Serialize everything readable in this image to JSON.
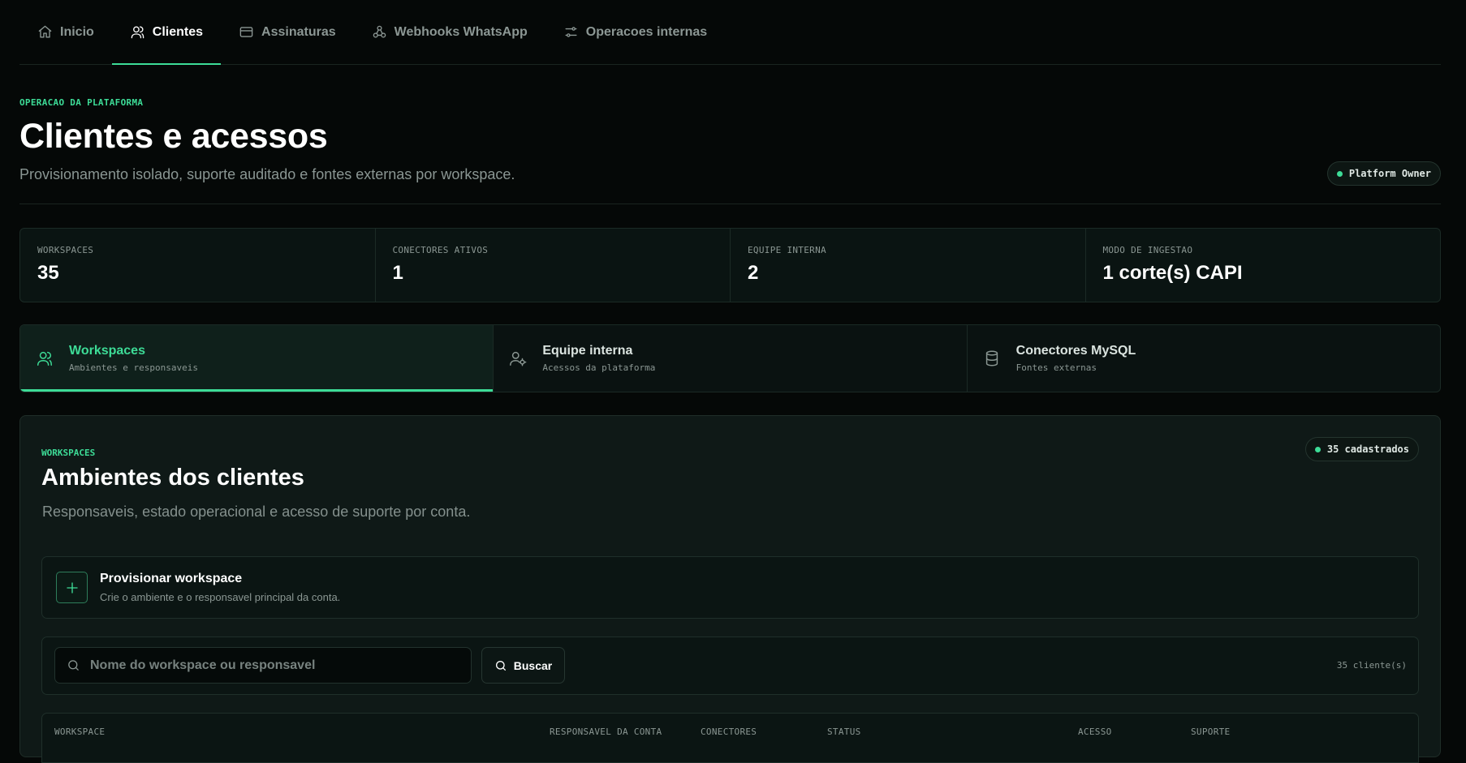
{
  "nav": [
    {
      "label": "Inicio",
      "icon": "home-icon",
      "active": false
    },
    {
      "label": "Clientes",
      "icon": "users-icon",
      "active": true
    },
    {
      "label": "Assinaturas",
      "icon": "credit-card-icon",
      "active": false
    },
    {
      "label": "Webhooks WhatsApp",
      "icon": "webhook-icon",
      "active": false
    },
    {
      "label": "Operacoes internas",
      "icon": "sliders-icon",
      "active": false
    }
  ],
  "header": {
    "eyebrow": "OPERACAO DA PLATAFORMA",
    "title": "Clientes e acessos",
    "subtitle": "Provisionamento isolado, suporte auditado e fontes externas por workspace.",
    "role_badge": "Platform Owner"
  },
  "stats": [
    {
      "label": "WORKSPACES",
      "value": "35"
    },
    {
      "label": "CONECTORES ATIVOS",
      "value": "1"
    },
    {
      "label": "EQUIPE INTERNA",
      "value": "2"
    },
    {
      "label": "MODO DE INGESTAO",
      "value": "1 corte(s) CAPI"
    }
  ],
  "tabs": [
    {
      "title": "Workspaces",
      "subtitle": "Ambientes e responsaveis",
      "icon": "users-icon",
      "active": true
    },
    {
      "title": "Equipe interna",
      "subtitle": "Acessos da plataforma",
      "icon": "user-settings-icon",
      "active": false
    },
    {
      "title": "Conectores MySQL",
      "subtitle": "Fontes externas",
      "icon": "database-icon",
      "active": false
    }
  ],
  "panel": {
    "eyebrow": "WORKSPACES",
    "title": "Ambientes dos clientes",
    "subtitle": "Responsaveis, estado operacional e acesso de suporte por conta.",
    "count_badge": "35 cadastrados",
    "provision": {
      "title": "Provisionar workspace",
      "subtitle": "Crie o ambiente e o responsavel principal da conta."
    },
    "search": {
      "placeholder": "Nome do workspace ou responsavel",
      "button_label": "Buscar",
      "result_count": "35 cliente(s)"
    },
    "table_columns": [
      "WORKSPACE",
      "RESPONSAVEL DA CONTA",
      "CONECTORES",
      "STATUS",
      "ACESSO",
      "SUPORTE"
    ]
  },
  "colors": {
    "accent": "#3ddc97",
    "background": "#050807",
    "panel": "#0f1917"
  }
}
